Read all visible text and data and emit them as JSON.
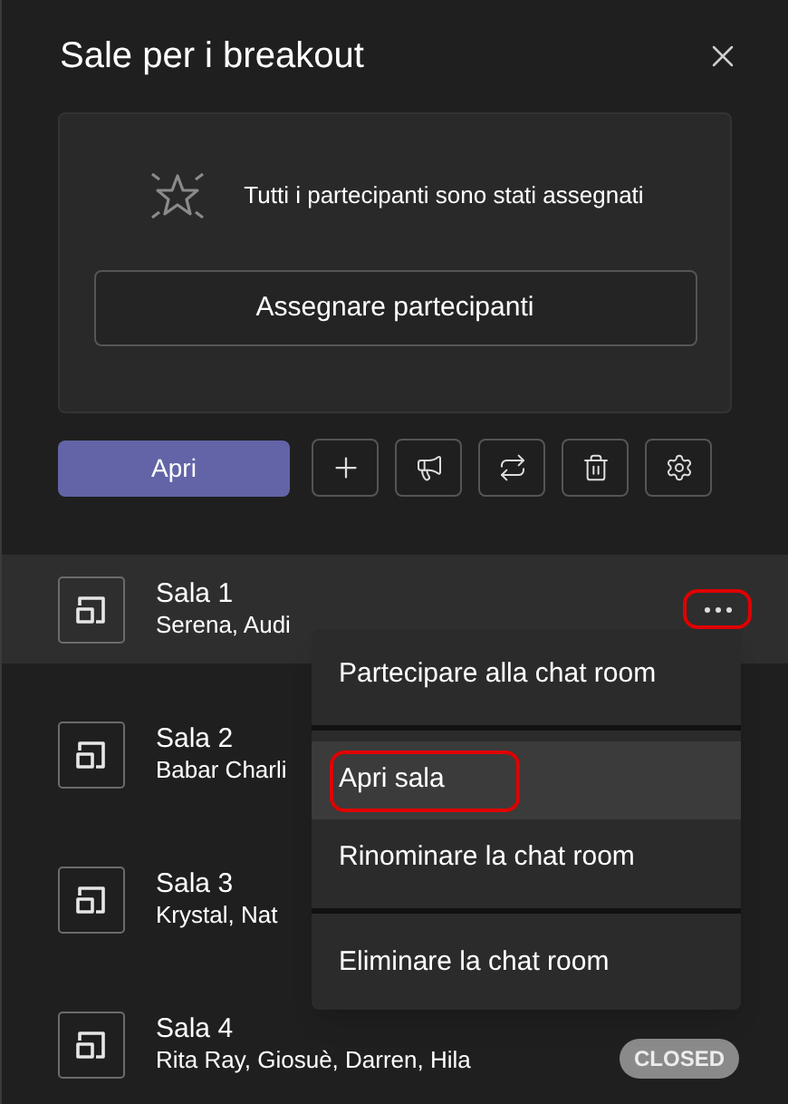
{
  "panel": {
    "title": "Sale per i breakout"
  },
  "assign_card": {
    "message": "Tutti i partecipanti sono stati assegnati",
    "button": "Assegnare partecipanti"
  },
  "toolbar": {
    "open_button": "Apri",
    "tools": [
      {
        "kind": "add"
      },
      {
        "kind": "announce"
      },
      {
        "kind": "recreate"
      },
      {
        "kind": "delete"
      },
      {
        "kind": "settings"
      }
    ]
  },
  "rooms": [
    {
      "name": "Sala 1",
      "participants": "Serena, Audi",
      "selected": true,
      "more_button": {
        "highlighted": true
      }
    },
    {
      "name": "Sala 2",
      "participants": "Babar Charli",
      "selected": false
    },
    {
      "name": "Sala 3",
      "participants": "Krystal, Nat",
      "selected": false
    },
    {
      "name": "Sala 4",
      "participants": "Rita Ray, Giosuè, Darren, Hila",
      "status": "CLOSED",
      "selected": false
    }
  ],
  "context_menu": {
    "items": [
      {
        "label": "Partecipare alla chat room",
        "selected": false,
        "highlighted": false
      },
      {
        "label": "Apri sala",
        "selected": true,
        "highlighted": true
      },
      {
        "label": "Rinominare la chat room",
        "selected": false,
        "highlighted": false
      },
      {
        "label": "Eliminare la chat room",
        "selected": false,
        "highlighted": false
      }
    ]
  }
}
